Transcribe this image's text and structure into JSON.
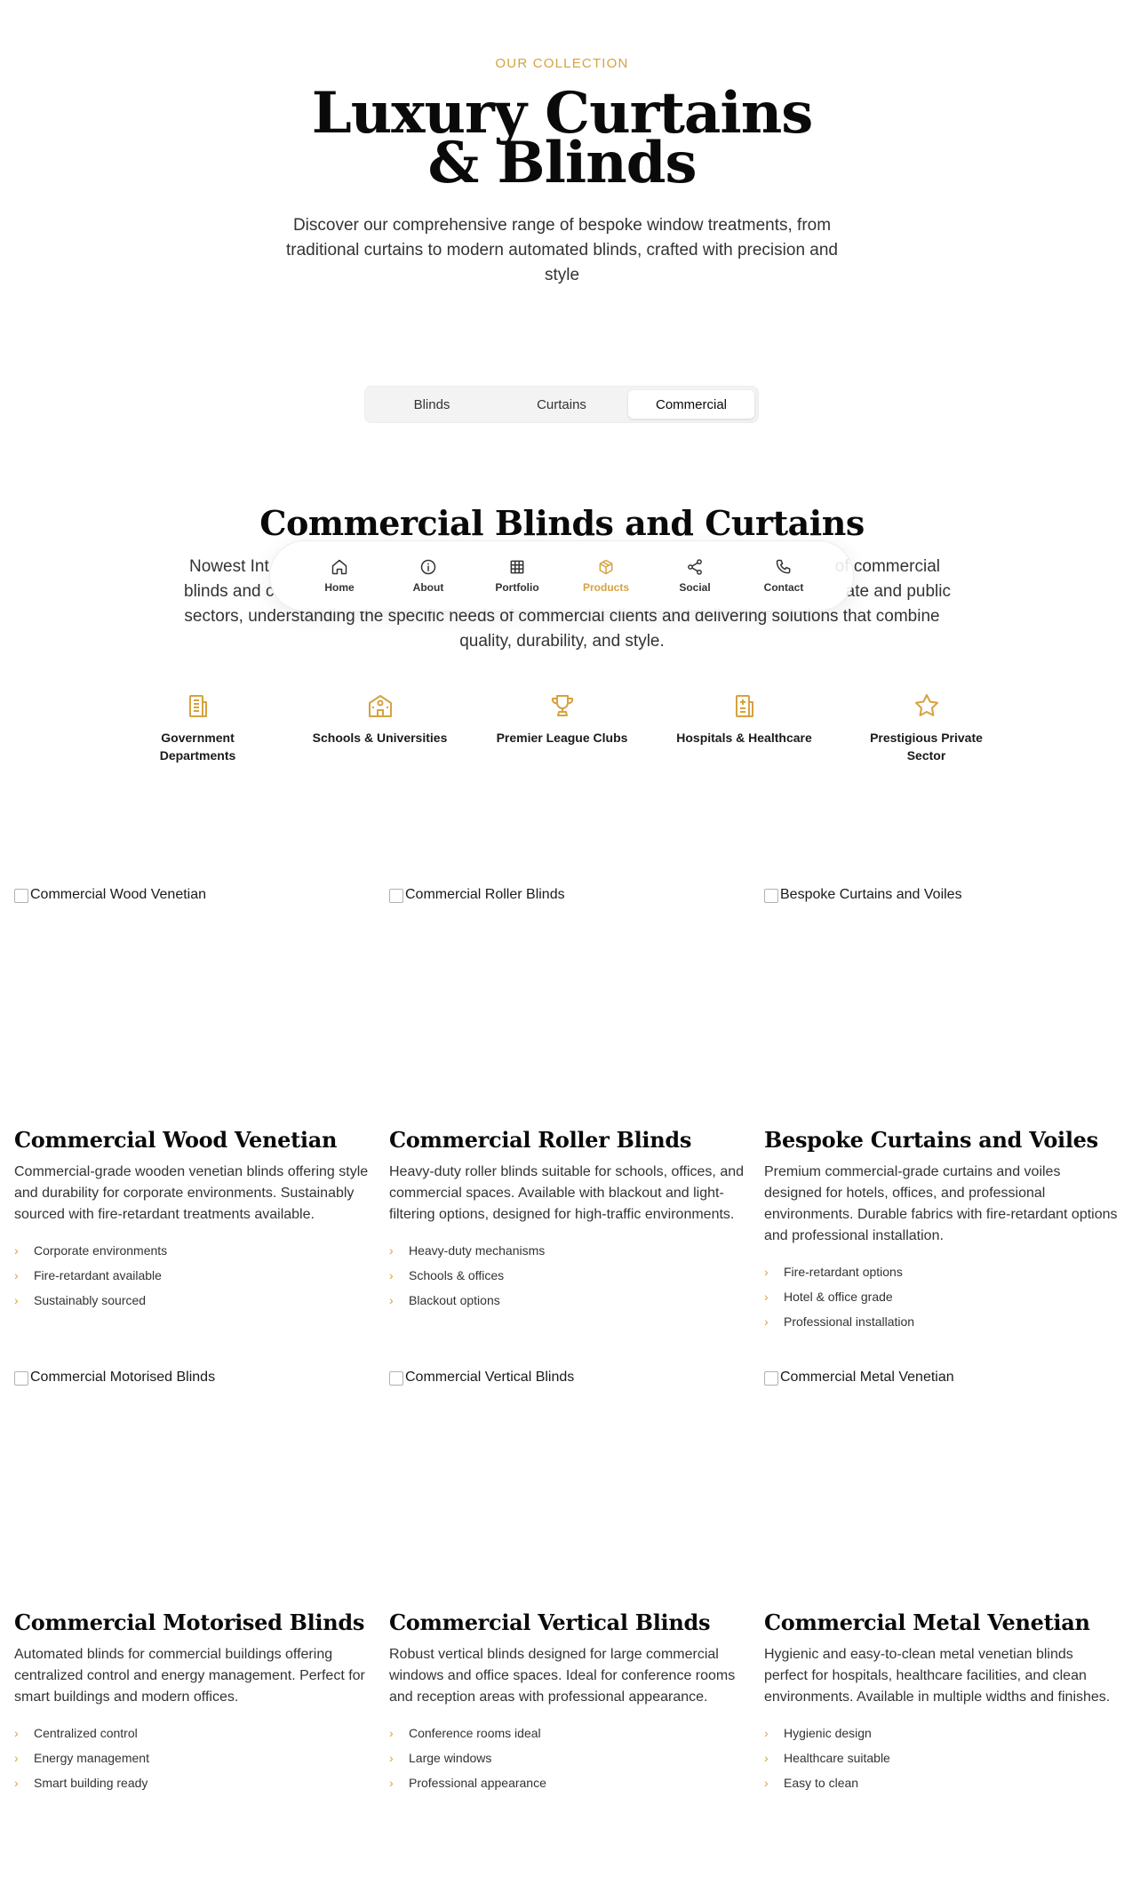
{
  "hero": {
    "eyebrow": "OUR COLLECTION",
    "title_line1": "Luxury Curtains",
    "title_line2": "& Blinds",
    "subtitle": "Discover our comprehensive range of bespoke window treatments, from traditional curtains to modern automated blinds, crafted with precision and style"
  },
  "tabs": [
    {
      "label": "Blinds",
      "active": false
    },
    {
      "label": "Curtains",
      "active": false
    },
    {
      "label": "Commercial",
      "active": true
    }
  ],
  "section": {
    "title": "Commercial Blinds and Curtains",
    "desc_visible_line1_left": "Nowest Int",
    "desc_visible_line1_right": "of commercial",
    "desc_visible_line2_left": "blinds and c",
    "desc_visible_line2_right": "ate and public",
    "desc_line3": "sectors, understanding the specific needs of commercial clients and delivering solutions that combine",
    "desc_line4": "quality, durability, and style."
  },
  "nav": [
    {
      "label": "Home",
      "icon": "home-icon"
    },
    {
      "label": "About",
      "icon": "info-icon"
    },
    {
      "label": "Portfolio",
      "icon": "grid-icon"
    },
    {
      "label": "Products",
      "icon": "box-icon",
      "active": true
    },
    {
      "label": "Social",
      "icon": "share-icon"
    },
    {
      "label": "Contact",
      "icon": "phone-icon"
    }
  ],
  "sectors": [
    {
      "label": "Government Departments",
      "icon": "building-icon"
    },
    {
      "label": "Schools & Universities",
      "icon": "school-icon"
    },
    {
      "label": "Premier League Clubs",
      "icon": "trophy-icon"
    },
    {
      "label": "Hospitals & Healthcare",
      "icon": "hospital-icon"
    },
    {
      "label": "Prestigious Private Sector",
      "icon": "star-icon"
    }
  ],
  "products": [
    {
      "img_alt": "Commercial Wood Venetian",
      "title": "Commercial Wood Venetian",
      "desc": "Commercial-grade wooden venetian blinds offering style and durability for corporate environments. Sustainably sourced with fire-retardant treatments available.",
      "features": [
        "Corporate environments",
        "Fire-retardant available",
        "Sustainably sourced"
      ]
    },
    {
      "img_alt": "Commercial Roller Blinds",
      "title": "Commercial Roller Blinds",
      "desc": "Heavy-duty roller blinds suitable for schools, offices, and commercial spaces. Available with blackout and light-filtering options, designed for high-traffic environments.",
      "features": [
        "Heavy-duty mechanisms",
        "Schools & offices",
        "Blackout options"
      ]
    },
    {
      "img_alt": "Bespoke Curtains and Voiles",
      "title": "Bespoke Curtains and Voiles",
      "desc": "Premium commercial-grade curtains and voiles designed for hotels, offices, and professional environments. Durable fabrics with fire-retardant options and professional installation.",
      "features": [
        "Fire-retardant options",
        "Hotel & office grade",
        "Professional installation"
      ]
    },
    {
      "img_alt": "Commercial Motorised Blinds",
      "title": "Commercial Motorised Blinds",
      "desc": "Automated blinds for commercial buildings offering centralized control and energy management. Perfect for smart buildings and modern offices.",
      "features": [
        "Centralized control",
        "Energy management",
        "Smart building ready"
      ]
    },
    {
      "img_alt": "Commercial Vertical Blinds",
      "title": "Commercial Vertical Blinds",
      "desc": "Robust vertical blinds designed for large commercial windows and office spaces. Ideal for conference rooms and reception areas with professional appearance.",
      "features": [
        "Conference rooms ideal",
        "Large windows",
        "Professional appearance"
      ]
    },
    {
      "img_alt": "Commercial Metal Venetian",
      "title": "Commercial Metal Venetian",
      "desc": "Hygienic and easy-to-clean metal venetian blinds perfect for hospitals, healthcare facilities, and clean environments. Available in multiple widths and finishes.",
      "features": [
        "Hygienic design",
        "Healthcare suitable",
        "Easy to clean"
      ]
    }
  ],
  "colors": {
    "accent": "#d6a23f",
    "text": "#1a1a1a"
  }
}
